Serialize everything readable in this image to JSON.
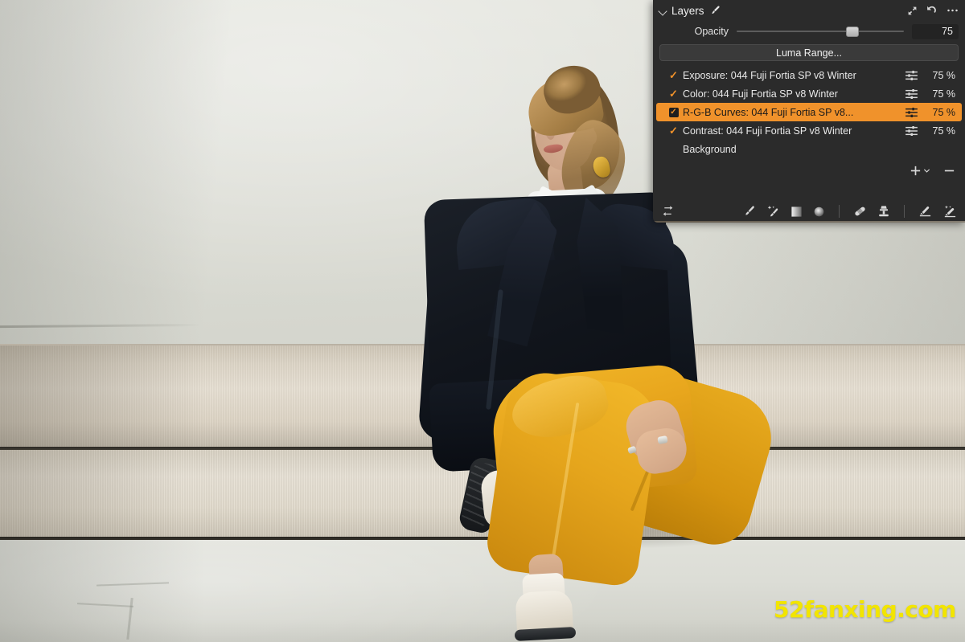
{
  "photo": {
    "description": "Woman with blonde updo hair seated on a beige couch against a pale grey-green wall",
    "subject_clothing": [
      "black blazer",
      "white shirt",
      "mustard yellow wide-leg trousers",
      "white sneakers"
    ],
    "watermark": "52fanxing.com",
    "watermark_color": "#f2e500"
  },
  "panel": {
    "title": "Layers",
    "collapse_icon": "chevron-down-icon",
    "brush_icon": "brush-icon",
    "expand_icon": "expand-arrows-icon",
    "reset_icon": "reset-arrow-icon",
    "more_icon": "more-options-icon",
    "accent_color": "#f0922b",
    "background_color": "#2b2b2b",
    "opacity": {
      "label": "Opacity",
      "value": "75",
      "slider_percent": 69
    },
    "luma_button": {
      "label": "Luma Range..."
    },
    "layers": [
      {
        "name": "Exposure: 044 Fuji Fortia SP v8 Winter",
        "checked": true,
        "selected": false,
        "mask_icon": "sliders-icon",
        "opacity": "75 %"
      },
      {
        "name": "Color: 044 Fuji Fortia SP v8 Winter",
        "checked": true,
        "selected": false,
        "mask_icon": "sliders-icon",
        "opacity": "75 %"
      },
      {
        "name": "R-G-B Curves: 044 Fuji Fortia SP v8...",
        "checked": true,
        "selected": true,
        "mask_icon": "sliders-icon",
        "opacity": "75 %"
      },
      {
        "name": "Contrast: 044 Fuji Fortia SP v8 Winter",
        "checked": true,
        "selected": false,
        "mask_icon": "sliders-icon",
        "opacity": "75 %"
      },
      {
        "name": "Background",
        "checked": false,
        "selected": false,
        "mask_icon": "",
        "opacity": ""
      }
    ],
    "add_button": {
      "label": "+",
      "dropdown_icon": "chevron-down-icon"
    },
    "remove_button": {
      "label": "−"
    },
    "tools": [
      {
        "name": "transfer-arrows-icon",
        "group": "left"
      },
      {
        "name": "brush-icon",
        "group": "middle"
      },
      {
        "name": "magic-brush-icon",
        "group": "middle"
      },
      {
        "name": "linear-gradient-icon",
        "group": "middle"
      },
      {
        "name": "radial-gradient-icon",
        "group": "middle"
      },
      {
        "name": "spot-heal-icon",
        "group": "repair"
      },
      {
        "name": "clone-stamp-icon",
        "group": "repair"
      },
      {
        "name": "eraser-icon",
        "group": "erase"
      },
      {
        "name": "magic-eraser-icon",
        "group": "erase"
      }
    ]
  }
}
